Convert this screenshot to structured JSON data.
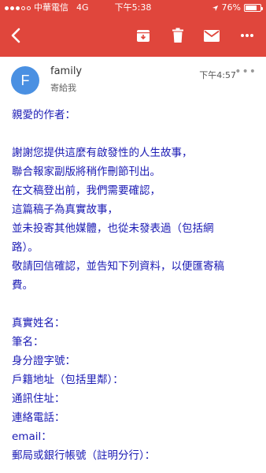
{
  "status_bar": {
    "carrier": "中華電信",
    "network": "4G",
    "time": "下午5:38",
    "battery": "76%",
    "battery_level": 0.76,
    "signal_bars_filled": 3,
    "signal_bars_total": 5
  },
  "toolbar": {
    "back_icon": "back-arrow-icon",
    "archive_icon": "archive-icon",
    "delete_icon": "trash-icon",
    "mail_icon": "mail-icon",
    "more_icon": "more-horizontal-icon",
    "accent_color": "#e0463c"
  },
  "message": {
    "avatar_letter": "F",
    "avatar_color": "#4a90e2",
    "sender": "family",
    "to_line": "寄給我",
    "time": "下午4:57",
    "more_label": "•••",
    "body_color": "#1a1ab4",
    "lines": [
      "親愛的作者：",
      "",
      "謝謝您提供這麼有啟發性的人生故事，",
      "聯合報家副版將稍作刪節刊出。",
      "在文稿登出前，我們需要確認，",
      "這篇稿子為真實故事，",
      "並未投寄其他媒體，也從未發表過（包括網",
      "路）。",
      "敬請回信確認，並告知下列資料，以便匯寄稿",
      "費。",
      "",
      "真實姓名：",
      "筆名：",
      "身分證字號：",
      "戶籍地址（包括里鄰）：",
      "通訊住址：",
      "連絡電話：",
      "email：",
      "郵局或銀行帳號（註明分行）："
    ]
  }
}
